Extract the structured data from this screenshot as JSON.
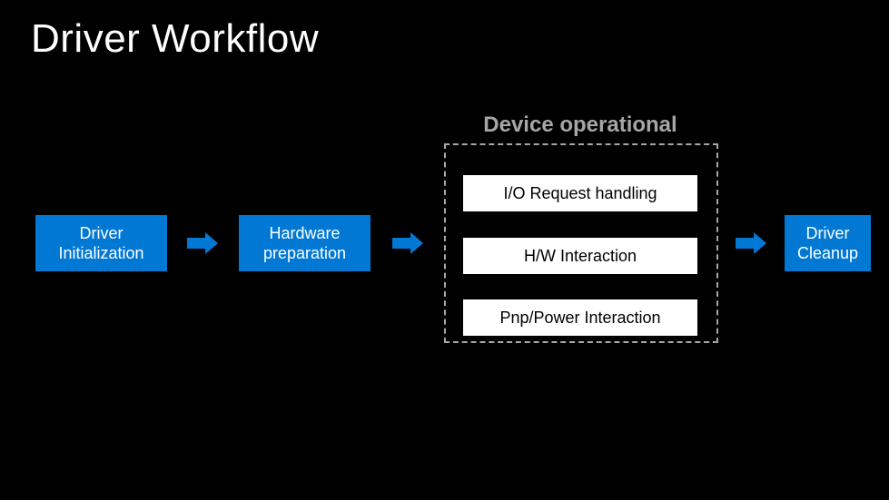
{
  "title": "Driver Workflow",
  "section_label": "Device operational",
  "boxes": {
    "driver_init": "Driver Initialization",
    "hw_prep": "Hardware preparation",
    "io_req": "I/O Request handling",
    "hw_inter": "H/W Interaction",
    "pnp_power": "Pnp/Power Interaction",
    "driver_cleanup": "Driver Cleanup"
  }
}
